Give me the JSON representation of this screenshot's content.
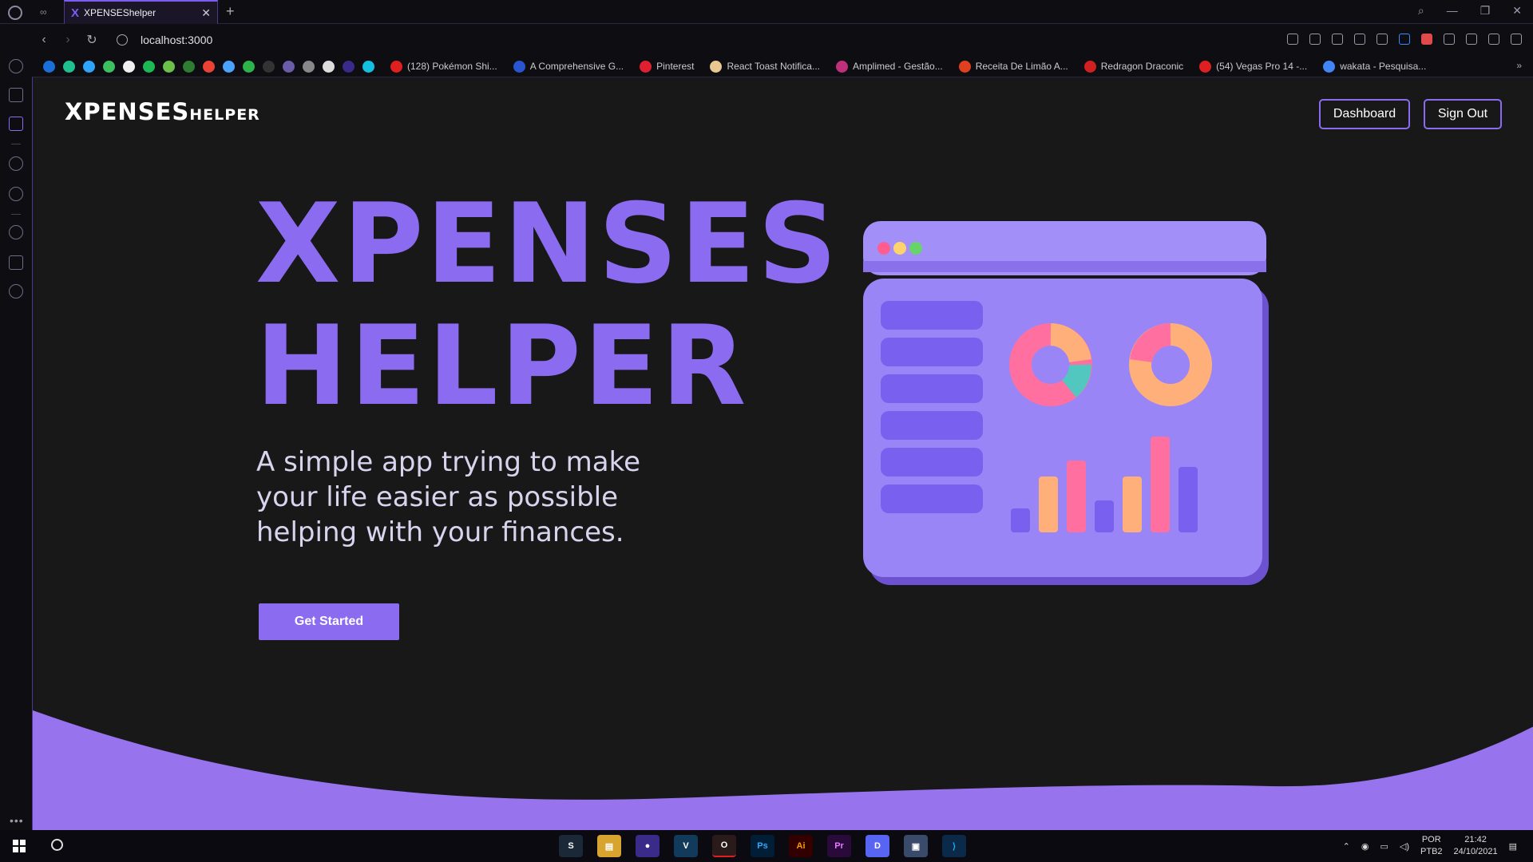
{
  "browser": {
    "tab_title": "XPENSEShelper",
    "url": "localhost:3000",
    "bookmarks": [
      {
        "label": "(128) Pokémon Shi...",
        "color": "#e02020"
      },
      {
        "label": "A Comprehensive G...",
        "color": "#2a55d0"
      },
      {
        "label": "Pinterest",
        "color": "#e02030"
      },
      {
        "label": "React Toast Notifica...",
        "color": "#e8c890"
      },
      {
        "label": "Amplimed - Gestão...",
        "color": "#c0307a"
      },
      {
        "label": "Receita De Limão A...",
        "color": "#e04020"
      },
      {
        "label": "Redragon Draconic",
        "color": "#d02020"
      },
      {
        "label": "(54) Vegas Pro 14 -...",
        "color": "#e02020"
      },
      {
        "label": "wakata - Pesquisa...",
        "color": "#4285f4"
      }
    ]
  },
  "nav": {
    "brand_big": "XPENSES",
    "brand_small": "HELPER",
    "dashboard": "Dashboard",
    "sign_out": "Sign Out"
  },
  "hero": {
    "title_line1": "XPENSES",
    "title_line2": "HELPER",
    "subtitle": "A simple app trying to make your life easier as possible helping with your finances.",
    "cta": "Get Started"
  },
  "taskbar": {
    "lang": "POR",
    "layout": "PTB2",
    "time": "21:42",
    "date": "24/10/2021"
  },
  "colors": {
    "accent": "#8b6bef",
    "background": "#181818",
    "wave": "#9774ee"
  }
}
